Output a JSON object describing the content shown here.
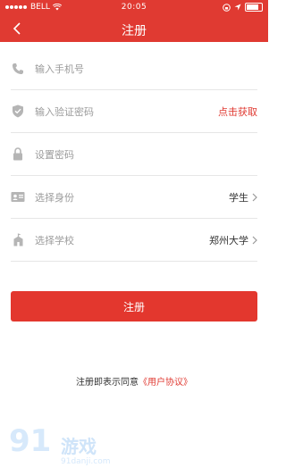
{
  "status_bar": {
    "carrier": "BELL",
    "time": "20:05"
  },
  "header": {
    "title": "注册"
  },
  "form": {
    "phone": {
      "placeholder": "输入手机号"
    },
    "code": {
      "placeholder": "输入验证密码",
      "action": "点击获取"
    },
    "password": {
      "placeholder": "设置密码"
    },
    "identity": {
      "label": "选择身份",
      "value": "学生"
    },
    "school": {
      "label": "选择学校",
      "value": "郑州大学"
    }
  },
  "submit_label": "注册",
  "agreement": {
    "prefix": "注册即表示同意",
    "link": "《用户协议》"
  },
  "watermark": {
    "logo": "91",
    "brand": "游戏",
    "domain": "91danji.com"
  },
  "colors": {
    "brand_red": "#e03a32",
    "icon_gray": "#b5b5b5"
  }
}
